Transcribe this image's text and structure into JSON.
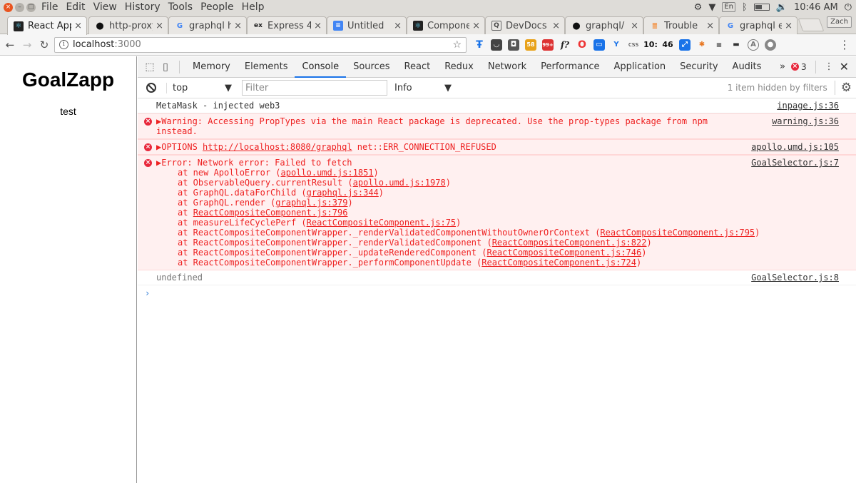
{
  "os": {
    "menu": [
      "File",
      "Edit",
      "View",
      "History",
      "Tools",
      "People",
      "Help"
    ],
    "keyboard": "En",
    "time": "10:46 AM"
  },
  "tabs": [
    {
      "title": "React App",
      "favicon": "react-icon",
      "active": true
    },
    {
      "title": "http-proxy",
      "favicon": "github-icon"
    },
    {
      "title": "graphql h",
      "favicon": "google-icon"
    },
    {
      "title": "Express 4",
      "favicon": "ex-icon"
    },
    {
      "title": "Untitled",
      "favicon": "docs-icon"
    },
    {
      "title": "Compone",
      "favicon": "react-icon"
    },
    {
      "title": "DevDocs",
      "favicon": "devdocs-icon"
    },
    {
      "title": "graphql/",
      "favicon": "github-icon"
    },
    {
      "title": "Trouble",
      "favicon": "stackoverflow-icon"
    },
    {
      "title": "graphql e",
      "favicon": "google-icon"
    }
  ],
  "profile": "Zach",
  "address": {
    "host": "localhost",
    "port": ":3000"
  },
  "extensions": {
    "badge1": "58",
    "badge2": "99+",
    "css": "css",
    "n1": "10:",
    "n2": "46",
    "f": "f?"
  },
  "page": {
    "title": "GoalZapp",
    "subtitle": "test"
  },
  "devtools": {
    "tabs": [
      "Memory",
      "Elements",
      "Console",
      "Sources",
      "React",
      "Redux",
      "Network",
      "Performance",
      "Application",
      "Security",
      "Audits"
    ],
    "active_tab": "Console",
    "error_count": "3",
    "context": "top",
    "filter_placeholder": "Filter",
    "level": "Info",
    "hidden_note": "1 item hidden by filters"
  },
  "console": {
    "m1": {
      "text": "MetaMask - injected web3",
      "src": "inpage.js:36"
    },
    "m2": {
      "text": "▶Warning: Accessing PropTypes via the main React package is deprecated. Use the prop-types package from npm instead.",
      "src": "warning.js:36"
    },
    "m3": {
      "prefix": "▶OPTIONS ",
      "url": "http://localhost:8080/graphql",
      "suffix": " net::ERR_CONNECTION_REFUSED",
      "src": "apollo.umd.js:105"
    },
    "m4": {
      "text": "▶Error: Network error: Failed to fetch",
      "src": "GoalSelector.js:7",
      "stack": [
        {
          "pre": "at new ApolloError (",
          "link": "apollo.umd.js:1851",
          "post": ")"
        },
        {
          "pre": "at ObservableQuery.currentResult (",
          "link": "apollo.umd.js:1978",
          "post": ")"
        },
        {
          "pre": "at GraphQL.dataForChild (",
          "link": "graphql.js:344",
          "post": ")"
        },
        {
          "pre": "at GraphQL.render (",
          "link": "graphql.js:379",
          "post": ")"
        },
        {
          "pre": "at ",
          "link": "ReactCompositeComponent.js:796",
          "post": ""
        },
        {
          "pre": "at measureLifeCyclePerf (",
          "link": "ReactCompositeComponent.js:75",
          "post": ")"
        },
        {
          "pre": "at ReactCompositeComponentWrapper._renderValidatedComponentWithoutOwnerOrContext (",
          "link": "ReactCompositeComponent.js:795",
          "post": ")"
        },
        {
          "pre": "at ReactCompositeComponentWrapper._renderValidatedComponent (",
          "link": "ReactCompositeComponent.js:822",
          "post": ")"
        },
        {
          "pre": "at ReactCompositeComponentWrapper._updateRenderedComponent (",
          "link": "ReactCompositeComponent.js:746",
          "post": ")"
        },
        {
          "pre": "at ReactCompositeComponentWrapper._performComponentUpdate (",
          "link": "ReactCompositeComponent.js:724",
          "post": ")"
        }
      ]
    },
    "m5": {
      "text": "undefined",
      "src": "GoalSelector.js:8"
    },
    "prompt": "›"
  }
}
